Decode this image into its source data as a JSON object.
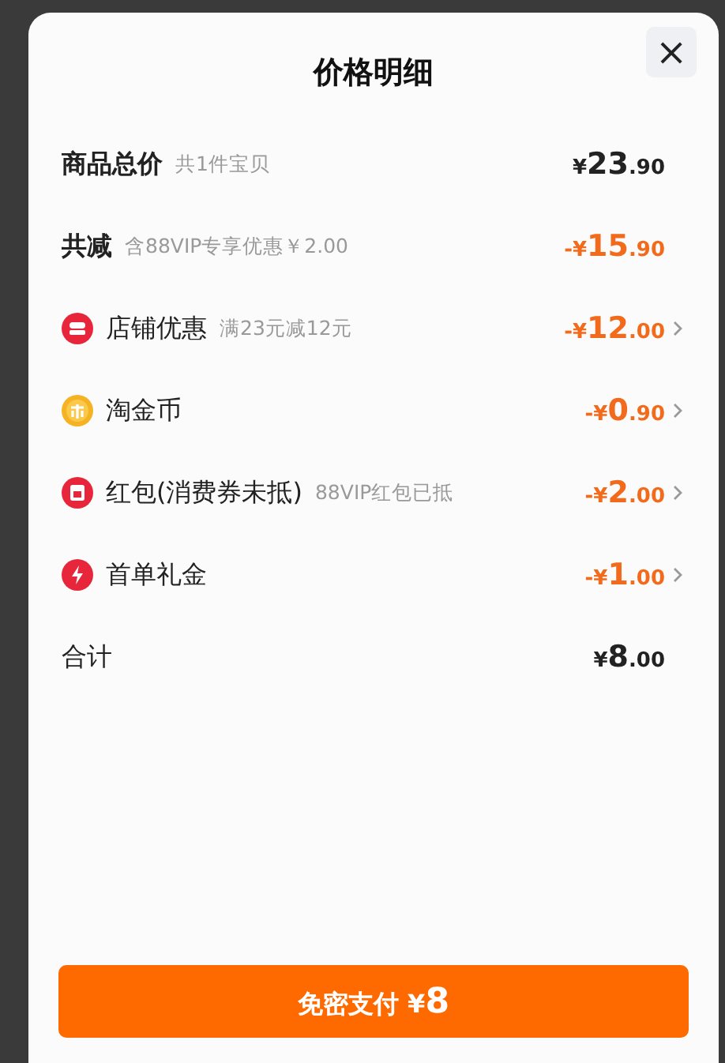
{
  "title": "价格明细",
  "close": "×",
  "rows": [
    {
      "label": "商品总价",
      "label_bold": true,
      "note": "共1件宝贝",
      "kind": "plain",
      "amount": {
        "yen": "¥",
        "integer": "23",
        "decimal": ".90"
      },
      "discount": false,
      "chevron": false
    },
    {
      "label": "共减",
      "label_bold": true,
      "note": "含88VIP专享优惠￥2.00",
      "kind": "plain",
      "amount": {
        "sign": "-",
        "yen": "¥",
        "integer": "15",
        "decimal": ".90"
      },
      "discount": true,
      "chevron": false
    },
    {
      "label": "店铺优惠",
      "label_bold": false,
      "note": "满23元减12元",
      "kind": "store",
      "amount": {
        "sign": "-",
        "yen": "¥",
        "integer": "12",
        "decimal": ".00"
      },
      "discount": true,
      "chevron": true
    },
    {
      "label": "淘金币",
      "label_bold": false,
      "kind": "coin",
      "amount": {
        "sign": "-",
        "yen": "¥",
        "integer": "0",
        "decimal": ".90"
      },
      "discount": true,
      "chevron": true
    },
    {
      "label": "红包(消费券未抵)",
      "label_bold": false,
      "note": "88VIP红包已抵",
      "kind": "packet",
      "amount": {
        "sign": "-",
        "yen": "¥",
        "integer": "2",
        "decimal": ".00"
      },
      "discount": true,
      "chevron": true
    },
    {
      "label": "首单礼金",
      "label_bold": false,
      "kind": "bolt",
      "amount": {
        "sign": "-",
        "yen": "¥",
        "integer": "1",
        "decimal": ".00"
      },
      "discount": true,
      "chevron": true
    },
    {
      "label": "合计",
      "label_bold": false,
      "kind": "plain",
      "amount": {
        "yen": "¥",
        "integer": "8",
        "decimal": ".00"
      },
      "discount": false,
      "chevron": false
    }
  ],
  "pay_button": {
    "label": "免密支付",
    "yen": "¥",
    "amount": "8"
  }
}
